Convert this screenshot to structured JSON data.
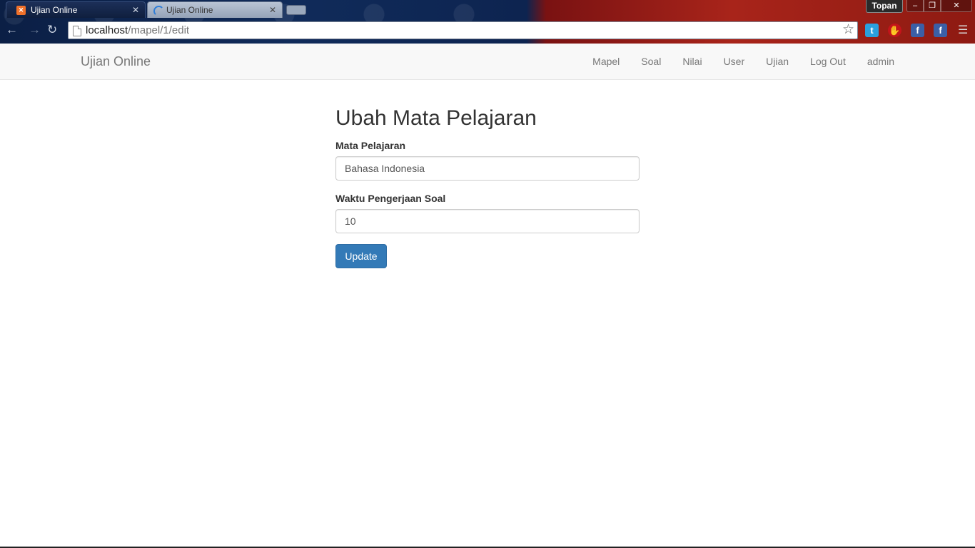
{
  "browser": {
    "tabs": [
      {
        "title": "Ujian Online",
        "active": true
      },
      {
        "title": "Ujian Online",
        "active": false
      }
    ],
    "user_label": "Topan",
    "window_buttons": {
      "minimize": "–",
      "maximize": "❐",
      "close": "✕"
    },
    "url_host": "localhost",
    "url_path": "/mapel/1/edit",
    "extensions": [
      "twitter-icon",
      "stop-icon",
      "facebook-icon",
      "facebook-icon"
    ]
  },
  "navbar": {
    "brand": "Ujian Online",
    "links": [
      "Mapel",
      "Soal",
      "Nilai",
      "User",
      "Ujian",
      "Log Out",
      "admin"
    ]
  },
  "form": {
    "title": "Ubah Mata Pelajaran",
    "subject_label": "Mata Pelajaran",
    "subject_value": "Bahasa Indonesia",
    "time_label": "Waktu Pengerjaan Soal",
    "time_value": "10",
    "submit_label": "Update"
  },
  "colors": {
    "primary": "#337ab7",
    "navbar_bg": "#f8f8f8",
    "navbar_text": "#777777"
  }
}
